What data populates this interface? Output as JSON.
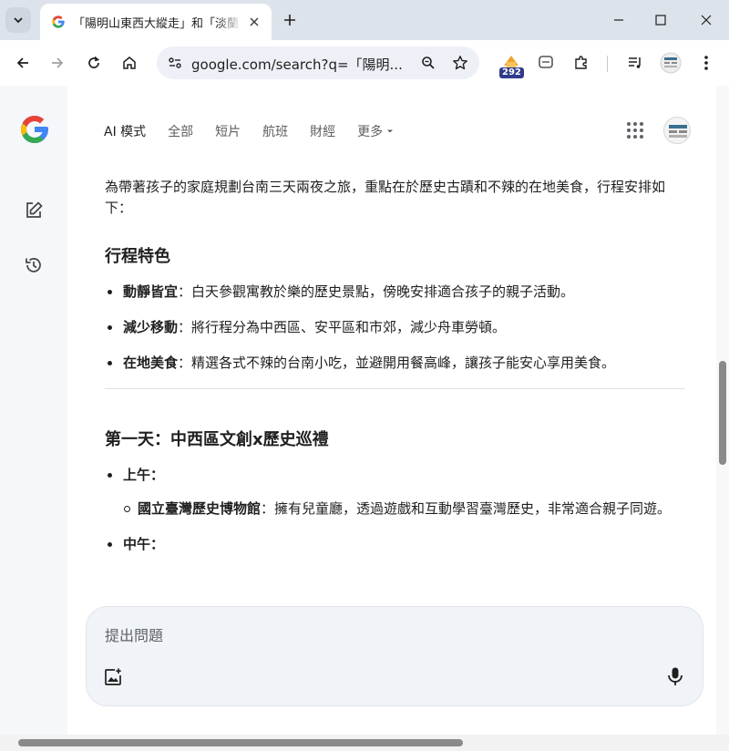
{
  "browser": {
    "tab_title": "「陽明山東西大縱走」和「淡蘭",
    "new_tab_label": "+",
    "address": "google.com/search?q=「陽明...",
    "extension_badge": "292"
  },
  "header": {
    "nav": [
      {
        "label": "AI 模式",
        "active": true
      },
      {
        "label": "全部"
      },
      {
        "label": "短片"
      },
      {
        "label": "航班"
      },
      {
        "label": "財經"
      },
      {
        "label": "更多"
      }
    ]
  },
  "answer": {
    "intro": "為帶著孩子的家庭規劃台南三天兩夜之旅，重點在於歷史古蹟和不辣的在地美食，行程安排如下：",
    "section1_title": "行程特色",
    "features": [
      {
        "term": "動靜皆宜",
        "text": "：白天參觀寓教於樂的歷史景點，傍晚安排適合孩子的親子活動。"
      },
      {
        "term": "減少移動",
        "text": "：將行程分為中西區、安平區和市郊，減少舟車勞頓。"
      },
      {
        "term": "在地美食",
        "text": "：精選各式不辣的台南小吃，並避開用餐高峰，讓孩子能安心享用美食。"
      }
    ],
    "day1_title": "第一天：中西區文創x歷史巡禮",
    "day1": {
      "morning_label": "上午：",
      "morning_item_term": "國立臺灣歷史博物館",
      "morning_item_text": "：擁有兒童廳，透過遊戲和互動學習臺灣歷史，非常適合親子同遊。",
      "noon_label": "中午："
    }
  },
  "ask": {
    "placeholder": "提出問題"
  }
}
